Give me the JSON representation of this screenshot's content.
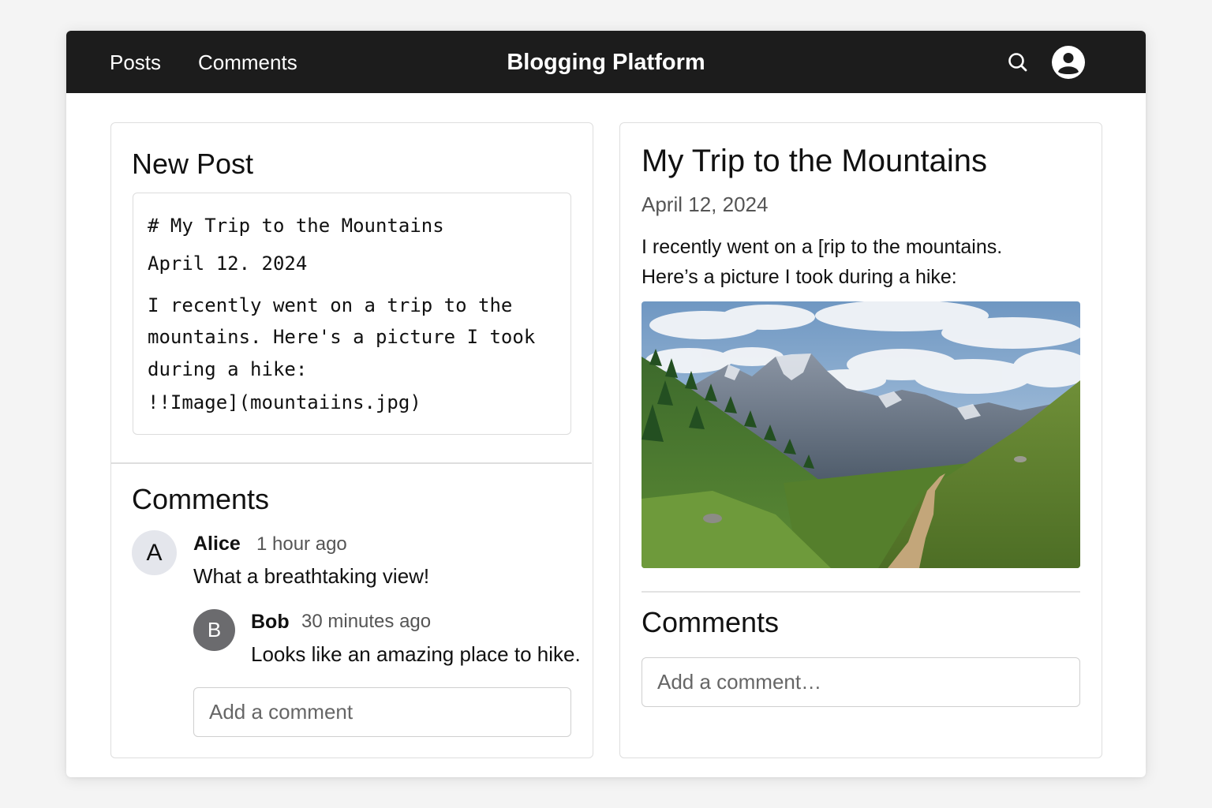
{
  "nav": {
    "links": [
      "Posts",
      "Comments"
    ],
    "title": "Blogging Platform",
    "search_icon": "search-icon",
    "profile_icon": "user-avatar-icon"
  },
  "editor_panel": {
    "heading": "New Post",
    "lines": [
      "# My Trip to the Mountains",
      "April 12. 2024",
      "I recently went on a trip to the",
      "mountains. Here's a picture I took",
      "during a hike:",
      "!!Image](mountaiins.jpg)"
    ],
    "comments": {
      "heading": "Comments",
      "items": [
        {
          "initial": "A",
          "author": "Alice",
          "time": "1 hour ago",
          "text": "What a breathtaking view!"
        },
        {
          "initial": "B",
          "author": "Bob",
          "time": "30 minutes ago",
          "text": "Looks like an amazing place to hike."
        }
      ],
      "input_placeholder": "Add a comment"
    }
  },
  "preview_panel": {
    "title": "My Trip to the Mountains",
    "date": "April 12, 2024",
    "body_lines": [
      "I recently went on a [rip to the mountains.",
      "Here’s a picture I took during a hike:"
    ],
    "image_subject": "mountain-valley-photo",
    "comments_heading": "Comments",
    "input_placeholder": "Add a comment…"
  },
  "colors": {
    "topbar": "#1c1c1c",
    "alice_avatar": "#e4e6ec",
    "bob_avatar": "#6b6b6e"
  }
}
